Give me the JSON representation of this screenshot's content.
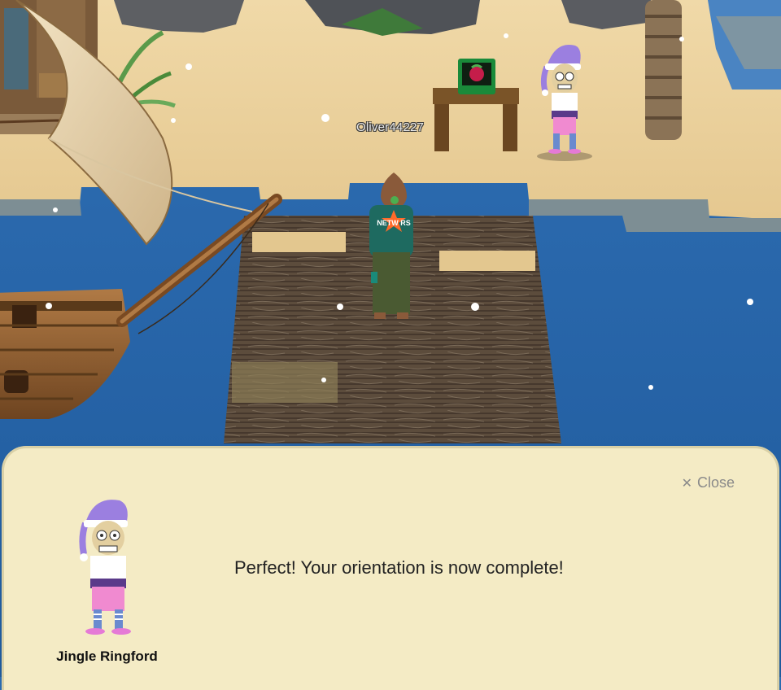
{
  "game": {
    "player_name": "Oliver44227",
    "player_shirt_text": "NETW RS"
  },
  "dialog": {
    "close_label": "Close",
    "close_icon": "close-icon",
    "message": "Perfect! Your orientation is now complete!",
    "speaker_name": "Jingle Ringford"
  },
  "colors": {
    "water": "#2a6bb0",
    "sand": "#ecd2a0",
    "dock": "#5a4a3a",
    "dialog_bg": "#f4ebc5",
    "elf_hat": "#9b7fe0",
    "elf_pants": "#f08ad0"
  }
}
